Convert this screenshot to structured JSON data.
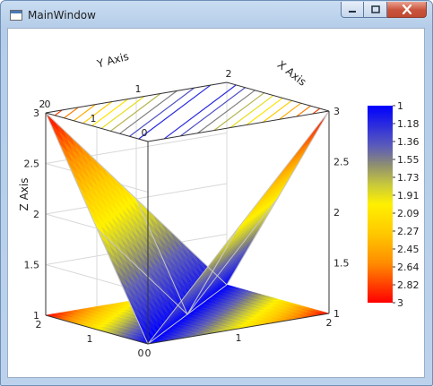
{
  "window": {
    "title": "MainWindow",
    "controls": {
      "minimize": "minimize-icon",
      "maximize": "maximize-icon",
      "close": "close-icon"
    }
  },
  "chart_data": {
    "type": "surface",
    "axes": {
      "x": {
        "label": "X Axis",
        "range": [
          0,
          2
        ],
        "ticks": [
          "0",
          "1",
          "2"
        ]
      },
      "y": {
        "label": "Y Axis",
        "range": [
          0,
          2
        ],
        "ticks": [
          "0",
          "1",
          "2"
        ]
      },
      "z": {
        "label": "Z Axis",
        "range": [
          1,
          3
        ],
        "ticks": [
          "1",
          "1.5",
          "2",
          "2.5",
          "3"
        ]
      }
    },
    "surface": {
      "function": "1 + |x - y|",
      "x": [
        0,
        1,
        2
      ],
      "y": [
        0,
        1,
        2
      ],
      "z_grid": [
        [
          1,
          2,
          3
        ],
        [
          2,
          1,
          2
        ],
        [
          3,
          2,
          1
        ]
      ]
    },
    "projection": "contour map at z = 1",
    "colorbar": {
      "labels": [
        "1",
        "1.18",
        "1.36",
        "1.55",
        "1.73",
        "1.91",
        "2.09",
        "2.27",
        "2.45",
        "2.64",
        "2.82",
        "3"
      ],
      "colors": {
        "low": "#0000ff",
        "mid_low": "#808080",
        "middle": "#ffff00",
        "mid_high": "#ffa500",
        "high": "#ff0000"
      }
    },
    "grid": true,
    "legend": "right"
  }
}
